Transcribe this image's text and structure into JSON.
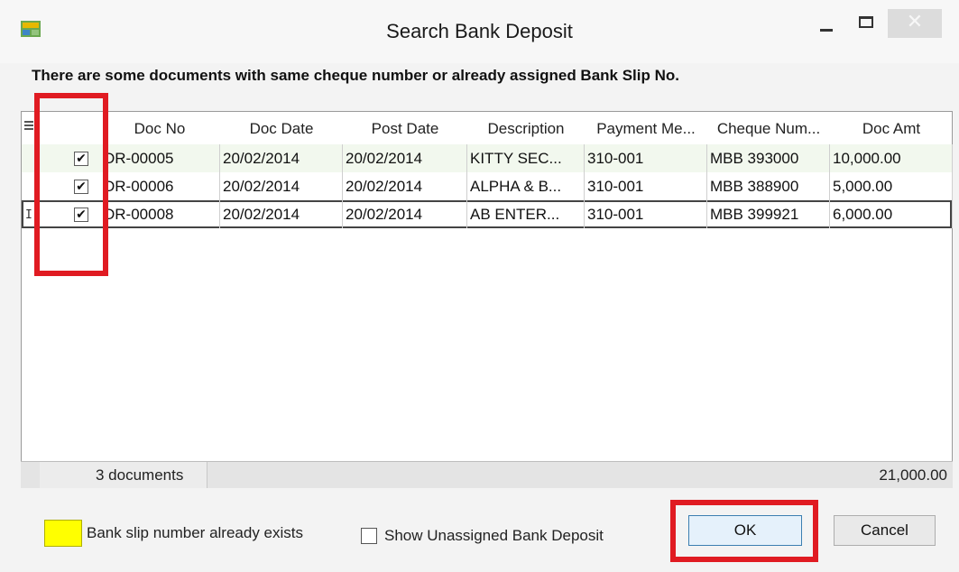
{
  "window": {
    "title": "Search Bank Deposit",
    "minimize_glyph": "",
    "maximize_glyph": "",
    "close_glyph": "✕"
  },
  "message": "There are some documents with same cheque number or already assigned Bank Slip No.",
  "grid": {
    "columns": [
      "Doc No",
      "Doc Date",
      "Post Date",
      "Description",
      "Payment Me...",
      "Cheque Num...",
      "Doc Amt"
    ],
    "rows": [
      {
        "checked": true,
        "doc_no": "DR-00005",
        "doc_date": "20/02/2014",
        "post_date": "20/02/2014",
        "description": "KITTY SEC...",
        "payment_method": "310-001",
        "cheque_no": "MBB 393000",
        "doc_amt": "10,000.00"
      },
      {
        "checked": true,
        "doc_no": "DR-00006",
        "doc_date": "20/02/2014",
        "post_date": "20/02/2014",
        "description": "ALPHA & B...",
        "payment_method": "310-001",
        "cheque_no": "MBB 388900",
        "doc_amt": "5,000.00"
      },
      {
        "checked": true,
        "doc_no": "DR-00008",
        "doc_date": "20/02/2014",
        "post_date": "20/02/2014",
        "description": "AB ENTER...",
        "payment_method": "310-001",
        "cheque_no": "MBB 399921",
        "doc_amt": "6,000.00"
      }
    ],
    "footer": {
      "count": "3 documents",
      "total": "21,000.00"
    },
    "check_glyph": "✔",
    "current_row_glyph": "I"
  },
  "legend": {
    "color": "#ffff00",
    "label": "Bank slip number already exists"
  },
  "show_unassigned": {
    "label": "Show Unassigned Bank Deposit",
    "checked": false
  },
  "buttons": {
    "ok": "OK",
    "cancel": "Cancel"
  },
  "colors": {
    "highlight": "#e01b22",
    "ok_border": "#3c7fb1"
  }
}
